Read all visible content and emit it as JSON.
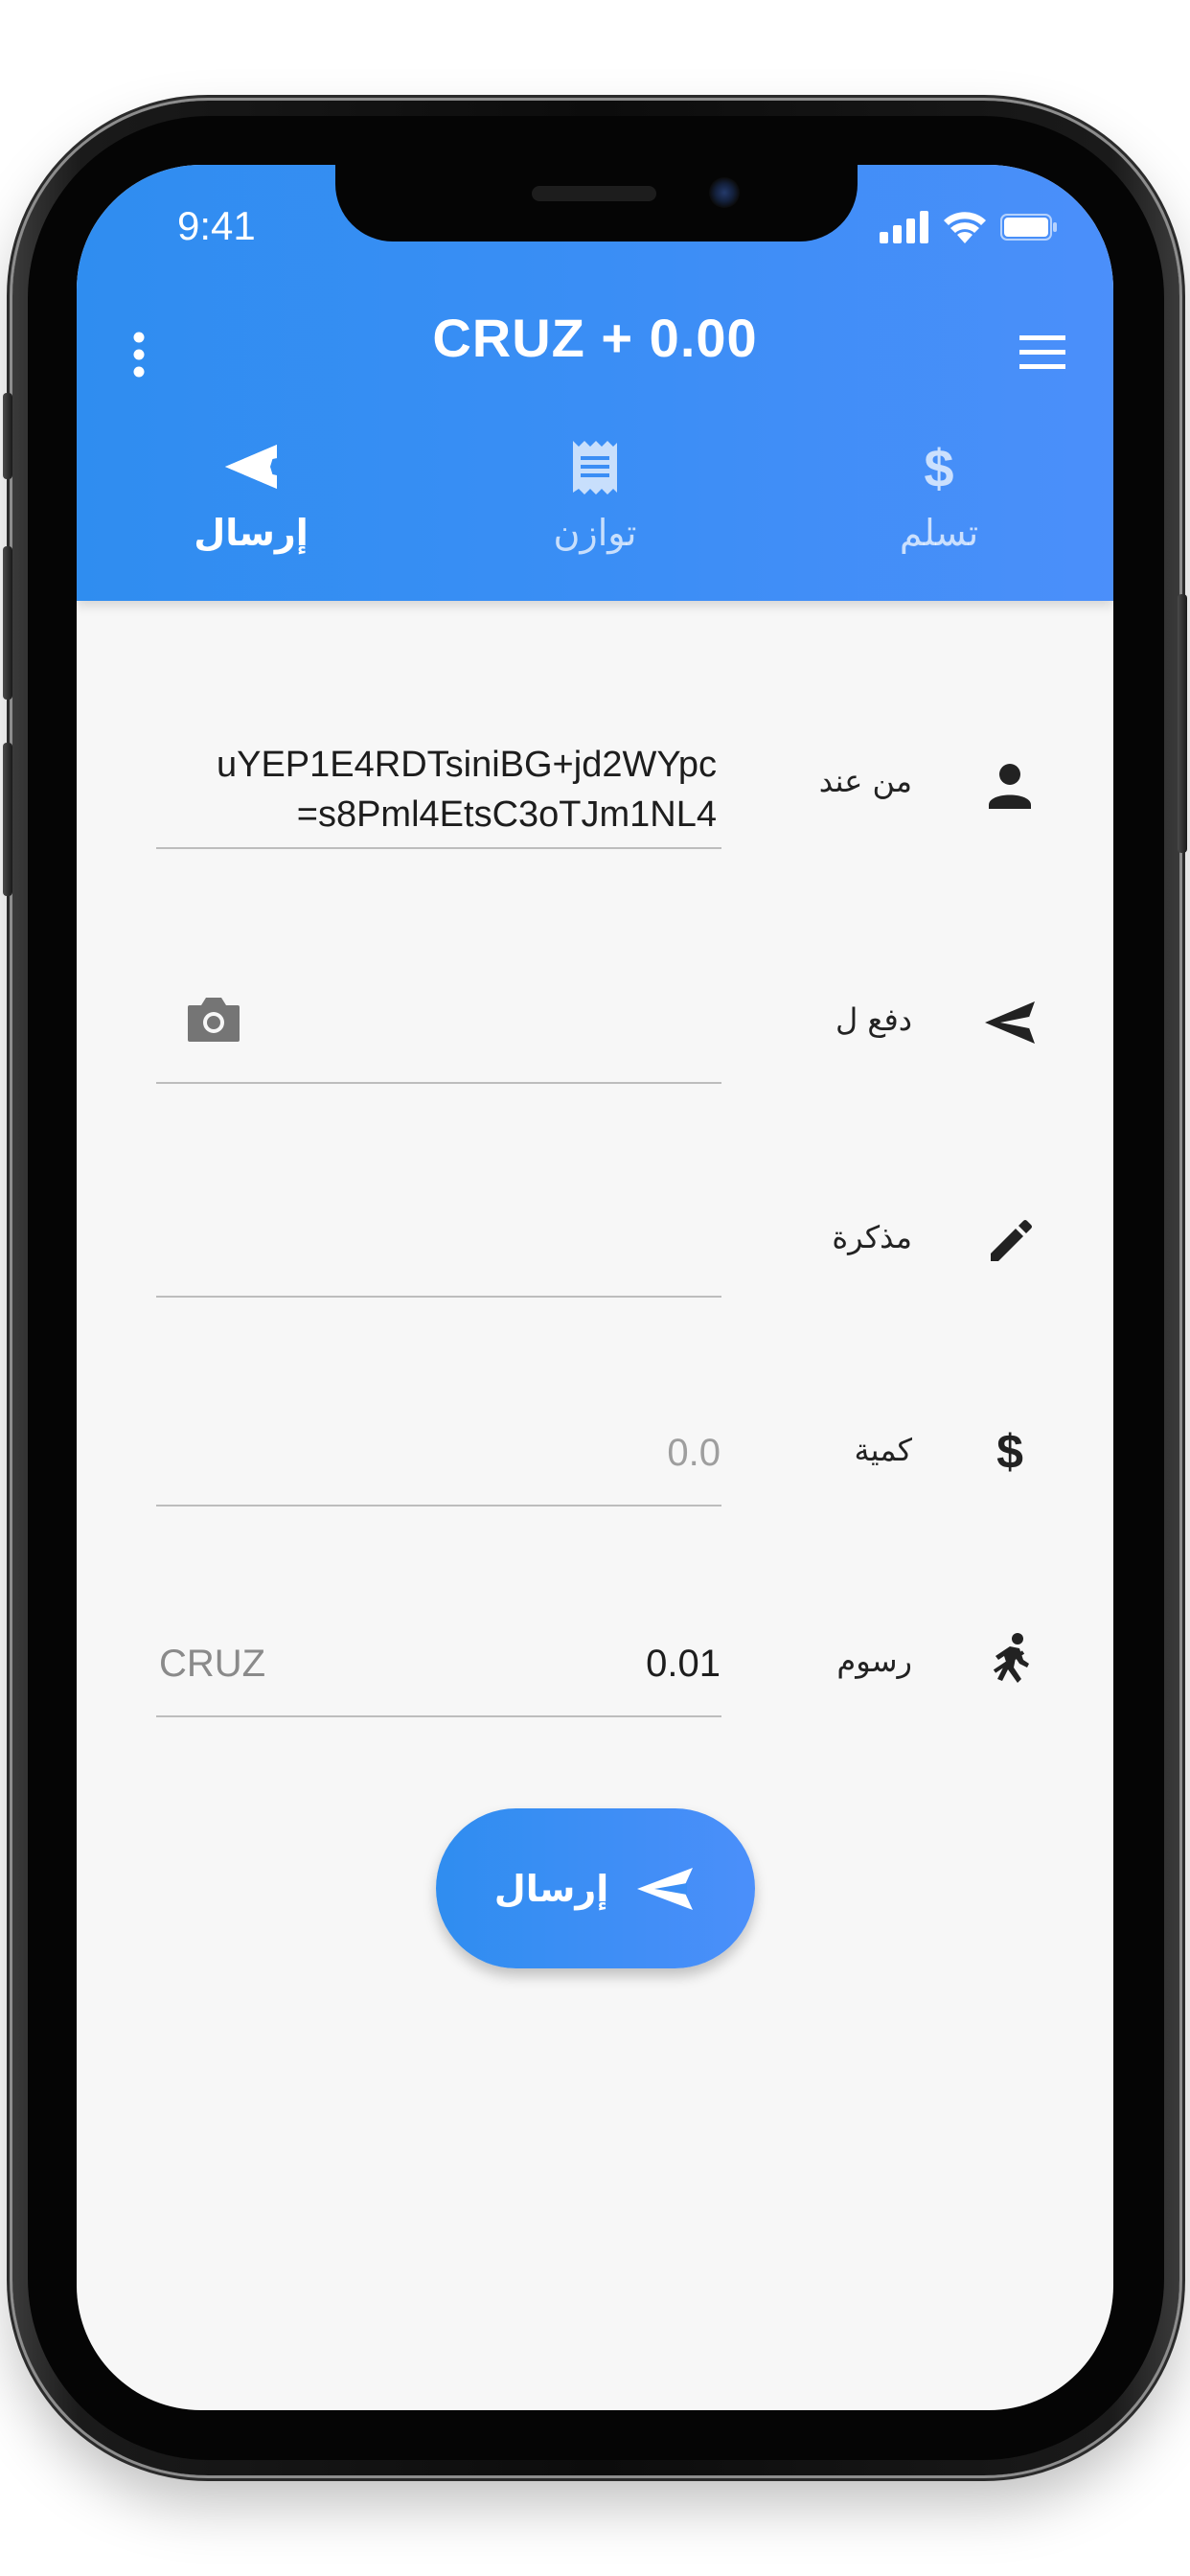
{
  "status_bar": {
    "time": "9:41"
  },
  "header": {
    "title": "CRUZ + 0.00",
    "accent_color": "#3a8ef5",
    "tabs": [
      {
        "label": "إرسال",
        "icon": "send-icon",
        "active": true
      },
      {
        "label": "توازن",
        "icon": "receipt-icon",
        "active": false
      },
      {
        "label": "تسلم",
        "icon": "dollar-icon",
        "active": false
      }
    ]
  },
  "form": {
    "from": {
      "label": "من عند",
      "icon": "person-icon",
      "address_line1": "uYEP1E4RDTsiniBG+jd2WYpc",
      "address_line2": "=s8Pml4EtsC3oTJm1NL4"
    },
    "pay_to": {
      "label": "دفع ل",
      "icon": "send-icon",
      "value": ""
    },
    "memo": {
      "label": "مذكرة",
      "icon": "pencil-icon",
      "value": ""
    },
    "amount": {
      "label": "كمية",
      "icon": "dollar-icon",
      "placeholder": "0.0"
    },
    "fee": {
      "label": "رسوم",
      "icon": "walk-icon",
      "value": "0.01",
      "suffix": "CRUZ"
    }
  },
  "send_button": {
    "label": "إرسال",
    "icon": "send-icon"
  }
}
